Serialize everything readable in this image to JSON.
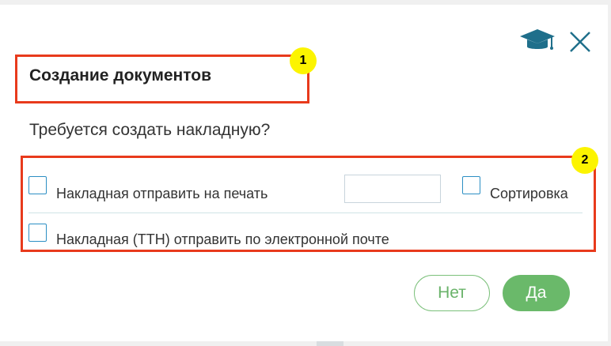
{
  "dialog": {
    "title": "Создание документов",
    "question": "Требуется создать накладную?",
    "icons": {
      "help": "graduation-cap-icon",
      "close": "close-icon"
    },
    "options": {
      "print": {
        "label": "Накладная отправить на печать",
        "checked": false
      },
      "copies": {
        "value": "",
        "placeholder": ""
      },
      "sort": {
        "label": "Сортировка",
        "checked": false
      },
      "email": {
        "label": "Накладная (ТТН) отправить по электронной почте",
        "checked": false
      }
    },
    "buttons": {
      "no": "Нет",
      "yes": "Да"
    }
  },
  "annotations": [
    {
      "number": "1"
    },
    {
      "number": "2"
    }
  ],
  "colors": {
    "accent_teal": "#1f6f8b",
    "checkbox_border": "#2c8fc4",
    "button_green": "#6ab96a",
    "highlight_red": "#e83a1c",
    "badge_yellow": "#fcf400"
  }
}
